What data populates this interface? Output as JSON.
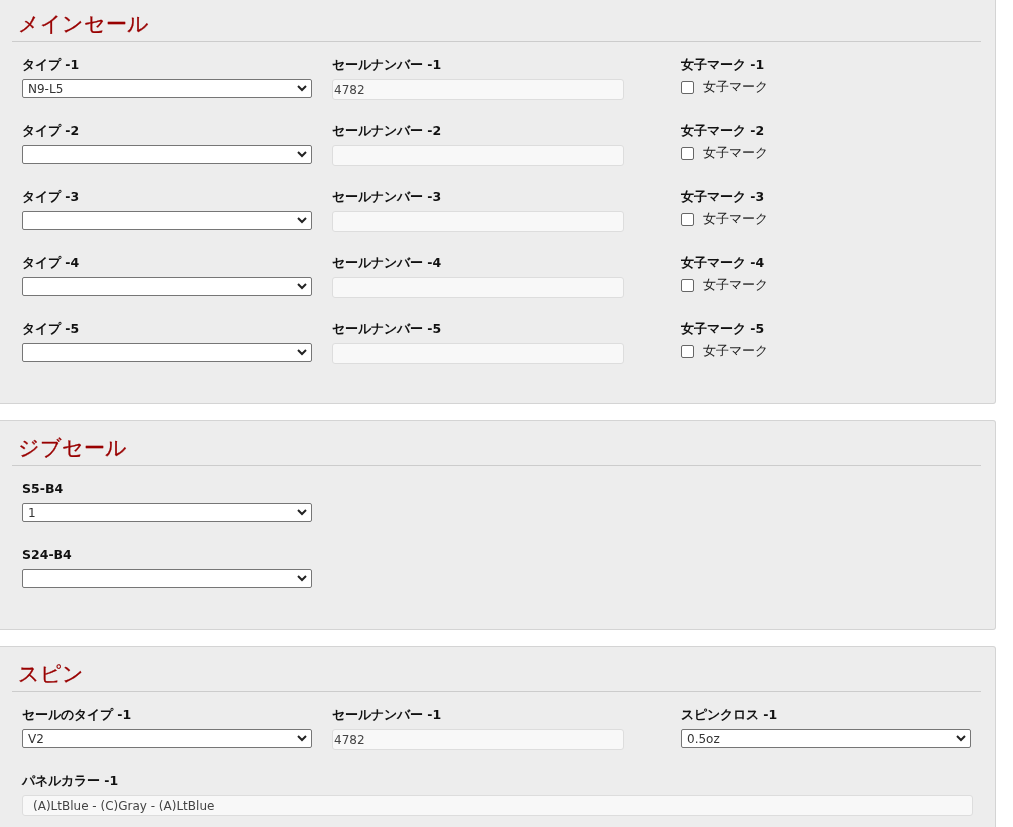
{
  "sections": [
    {
      "title": "メインセール",
      "rows": [
        [
          {
            "kind": "select",
            "label": "タイプ -1",
            "value": "N9-L5"
          },
          {
            "kind": "text",
            "label": "セールナンバー -1",
            "value": "4782"
          },
          {
            "kind": "checkbox",
            "label": "女子マーク -1",
            "option": "女子マーク",
            "checked": false
          }
        ],
        [
          {
            "kind": "select",
            "label": "タイプ -2"
          },
          {
            "kind": "text",
            "label": "セールナンバー -2"
          },
          {
            "kind": "checkbox",
            "label": "女子マーク -2",
            "option": "女子マーク",
            "checked": false
          }
        ],
        [
          {
            "kind": "select",
            "label": "タイプ -3"
          },
          {
            "kind": "text",
            "label": "セールナンバー -3"
          },
          {
            "kind": "checkbox",
            "label": "女子マーク -3",
            "option": "女子マーク",
            "checked": false
          }
        ],
        [
          {
            "kind": "select",
            "label": "タイプ -4"
          },
          {
            "kind": "text",
            "label": "セールナンバー -4"
          },
          {
            "kind": "checkbox",
            "label": "女子マーク -4",
            "option": "女子マーク",
            "checked": false
          }
        ],
        [
          {
            "kind": "select",
            "label": "タイプ -5"
          },
          {
            "kind": "text",
            "label": "セールナンバー -5"
          },
          {
            "kind": "checkbox",
            "label": "女子マーク -5",
            "option": "女子マーク",
            "checked": false
          }
        ]
      ]
    },
    {
      "title": "ジブセール",
      "rows": [
        [
          {
            "kind": "select",
            "label": "S5-B4",
            "value": "1"
          }
        ],
        [
          {
            "kind": "select",
            "label": "S24-B4"
          }
        ]
      ]
    },
    {
      "title": "スピン",
      "rows": [
        [
          {
            "kind": "select",
            "label": "セールのタイプ -1",
            "value": "V2"
          },
          {
            "kind": "text",
            "label": "セールナンバー -1",
            "value": "4782"
          },
          {
            "kind": "select",
            "label": "スピンクロス -1",
            "value": "0.5oz"
          }
        ],
        [
          {
            "kind": "wide_text",
            "label": "パネルカラー -1",
            "value": "(A)LtBlue - (C)Gray - (A)LtBlue"
          }
        ]
      ]
    }
  ]
}
